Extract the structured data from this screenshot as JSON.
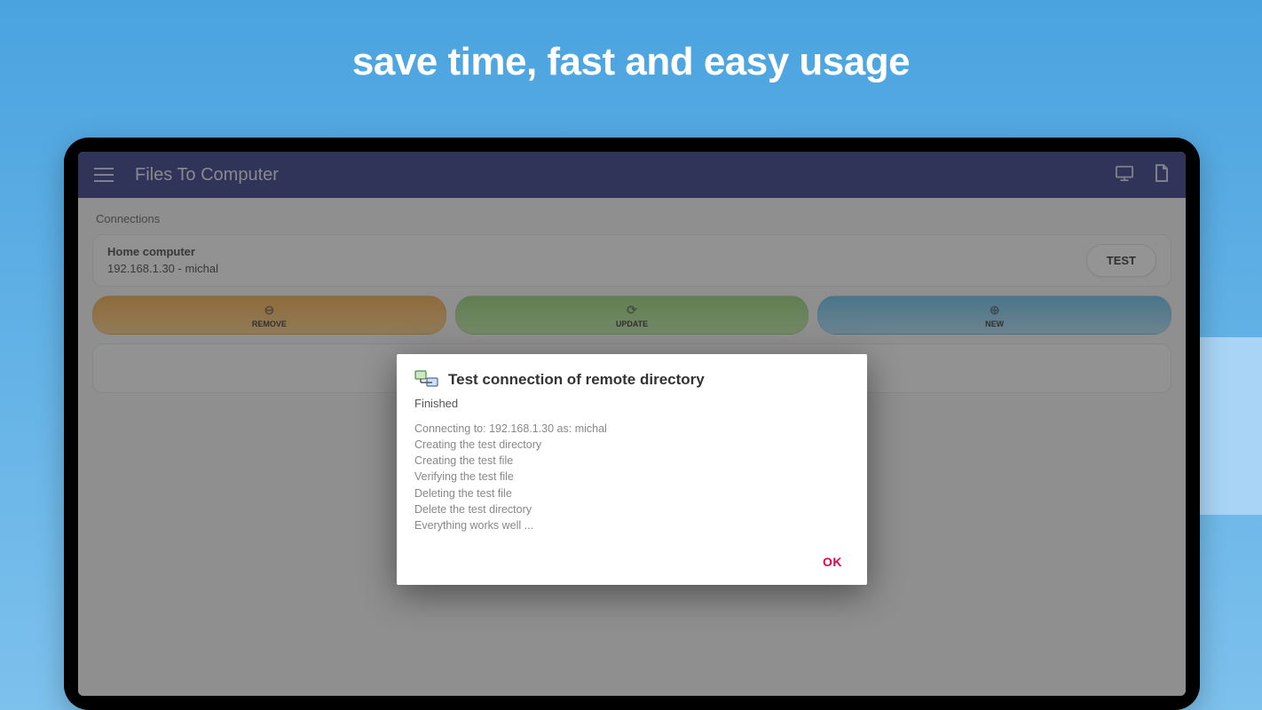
{
  "promo": {
    "headline": "save time, fast and easy usage"
  },
  "appbar": {
    "title": "Files To Computer"
  },
  "section": {
    "label": "Connections"
  },
  "connection": {
    "name": "Home computer",
    "detail": "192.168.1.30 - michal",
    "test_label": "TEST"
  },
  "actions": {
    "remove": "REMOVE",
    "update": "UPDATE",
    "new": "NEW"
  },
  "dialog": {
    "title": "Test connection of remote directory",
    "status": "Finished",
    "log": [
      "Connecting to: 192.168.1.30 as: michal",
      "Creating the test directory",
      "Creating the test file",
      "Verifying the test file",
      "Deleting the test file",
      "Delete the test directory",
      "Everything works well ..."
    ],
    "ok_label": "OK"
  }
}
